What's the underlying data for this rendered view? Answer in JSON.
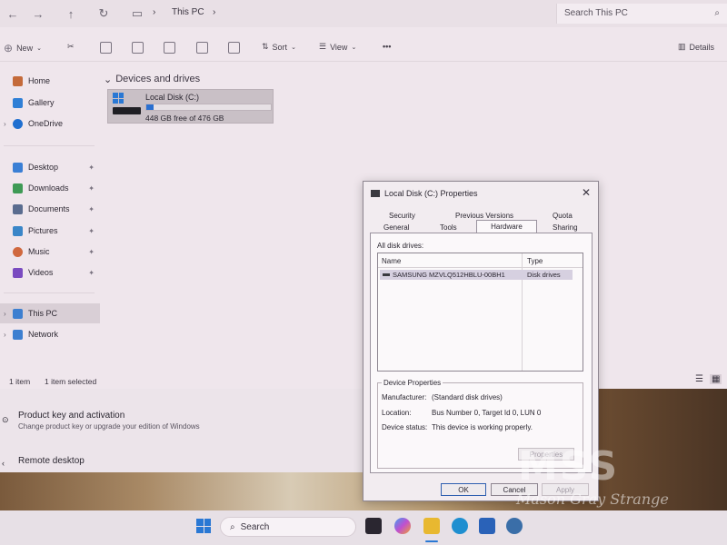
{
  "explorer": {
    "breadcrumb": [
      "This PC"
    ],
    "search_placeholder": "Search This PC",
    "toolbar": {
      "new": "New",
      "sort": "Sort",
      "view": "View",
      "more": "•••",
      "details": "Details"
    },
    "sidebar": {
      "top": [
        {
          "label": "Home",
          "icon": "home-icon"
        },
        {
          "label": "Gallery",
          "icon": "gallery-icon"
        },
        {
          "label": "OneDrive",
          "icon": "cloud-icon"
        }
      ],
      "quick": [
        {
          "label": "Desktop",
          "icon": "desktop-icon"
        },
        {
          "label": "Downloads",
          "icon": "download-icon"
        },
        {
          "label": "Documents",
          "icon": "documents-icon"
        },
        {
          "label": "Pictures",
          "icon": "pictures-icon"
        },
        {
          "label": "Music",
          "icon": "music-icon"
        },
        {
          "label": "Videos",
          "icon": "videos-icon"
        }
      ],
      "bottom": [
        {
          "label": "This PC",
          "icon": "pc-icon",
          "selected": true
        },
        {
          "label": "Network",
          "icon": "network-icon"
        }
      ]
    },
    "group_title": "Devices and drives",
    "drive": {
      "name": "Local Disk (C:)",
      "free_text": "448 GB free of 476 GB",
      "used_fraction": 0.06
    },
    "status": {
      "count": "1 item",
      "selected": "1 item selected"
    }
  },
  "settings": {
    "items": [
      {
        "title": "Product key and activation",
        "subtitle": "Change product key or upgrade your edition of Windows"
      },
      {
        "title": "Remote desktop",
        "subtitle": ""
      }
    ]
  },
  "dialog": {
    "title": "Local Disk (C:) Properties",
    "tabs_row1": [
      "Security",
      "Previous Versions",
      "Quota"
    ],
    "tabs_row2": [
      "General",
      "Tools",
      "Hardware",
      "Sharing"
    ],
    "active_tab": "Hardware",
    "all_disk_drives": "All disk drives:",
    "columns": [
      "Name",
      "Type"
    ],
    "rows": [
      {
        "name": "SAMSUNG MZVLQ512HBLU-00BH1",
        "type": "Disk drives"
      }
    ],
    "device_properties_title": "Device Properties",
    "manufacturer_label": "Manufacturer:",
    "manufacturer_value": "(Standard disk drives)",
    "location_label": "Location:",
    "location_value": "Bus Number 0, Target Id 0, LUN 0",
    "status_label": "Device status:",
    "status_value": "This device is working properly.",
    "properties_button": "Properties",
    "ok": "OK",
    "cancel": "Cancel",
    "apply": "Apply"
  },
  "taskbar": {
    "search": "Search"
  },
  "watermark": {
    "logo": "MSS",
    "text": "Mason Gray Strange"
  }
}
